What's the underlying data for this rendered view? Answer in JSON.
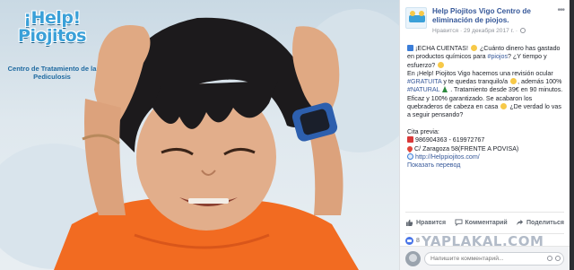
{
  "photo": {
    "brand_title": "¡Help! Piojitos",
    "brand_subtitle": "Centro de Tratamiento de la Pediculosis"
  },
  "post_header": {
    "page_name": "Help Piojitos Vigo Centro de eliminación de piojos.",
    "like_label": "Нравится",
    "date": "29 декабря 2017 г.",
    "more_icon": "ellipsis-icon"
  },
  "post_body": {
    "line1_prefix": "¡ECHA CUENTAS!",
    "line1_rest": " ¿Cuánto dinero has gastado en productos químicos para ",
    "hashtag_piojos": "#piojos",
    "line1_end": "? ¿Y tiempo y esfuerzo?",
    "para2_start": "En ¡Help! Piojitos Vigo hacemos una revisión ocular ",
    "hashtag_gratuita": "#GRATUITA",
    "para2_mid": " y te quedas tranquilo/a",
    "para2_mid2": ", además 100% ",
    "hashtag_natural": "#NATURAL",
    "para2_end": " . Tratamiento desde 39€ en 90 minutos. Eficaz y 100% garantizado. Se acabaron los quebraderos de cabeza en casa",
    "para2_tail": " ¿De verdad lo vas a seguir pensando?",
    "cita": "Cita previa:",
    "phone": "986904363 - 619972767",
    "address": "C/ Zaragoza 58(FRENTE A POVISA)",
    "website": "http://Helppiojitos.com/",
    "translate": "Показать перевод"
  },
  "actions": {
    "like": "Нравится",
    "comment": "Комментарий",
    "share": "Поделиться"
  },
  "reactions": {
    "count": "8"
  },
  "comment_box": {
    "placeholder": "Напишите комментарий..."
  },
  "watermark": "YAPLAKAL.COM",
  "colors": {
    "facebook_link": "#365899",
    "shirt": "#f26b21",
    "watch": "#2d5fae"
  }
}
